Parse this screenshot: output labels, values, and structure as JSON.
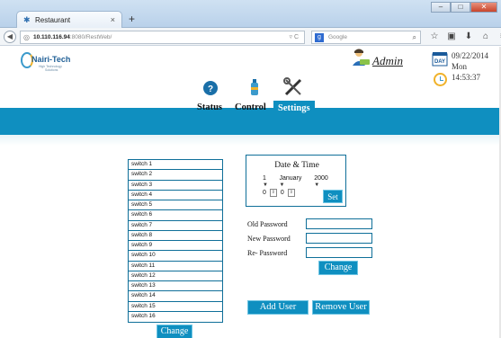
{
  "browser": {
    "tab_title": "Restaurant",
    "tab_close": "×",
    "new_tab": "+",
    "url_host": "10.110.116.94",
    "url_path": ":8080/RestWeb/",
    "url_tools": "▿ C",
    "search_placeholder": "Google",
    "window_buttons": [
      "–",
      "□",
      "✕"
    ]
  },
  "header": {
    "logo_name": "Nairi-Tech",
    "logo_tag1": "High Technology",
    "logo_tag2": "Solutions",
    "admin_name": "Admin",
    "date": "09/22/2014",
    "day": "Mon",
    "time": "14:53:37"
  },
  "menu": {
    "status": "Status",
    "control": "Control",
    "settings": "Settings"
  },
  "switches": [
    "switch 1",
    "switch 2",
    "switch 3",
    "switch 4",
    "switch 5",
    "switch 6",
    "switch 7",
    "switch 8",
    "switch 9",
    "switch 10",
    "switch 11",
    "switch 12",
    "switch 13",
    "switch 14",
    "switch 15",
    "switch 16"
  ],
  "switch_change": "Change",
  "datetime": {
    "title": "Date & Time",
    "day": "1",
    "month": "January",
    "year": "2000",
    "hour": "0",
    "minute": "0",
    "set": "Set"
  },
  "password": {
    "old": "Old Password",
    "new": "New Password",
    "re": "Re- Password",
    "change": "Change"
  },
  "users": {
    "add": "Add User",
    "remove": "Remove User"
  }
}
